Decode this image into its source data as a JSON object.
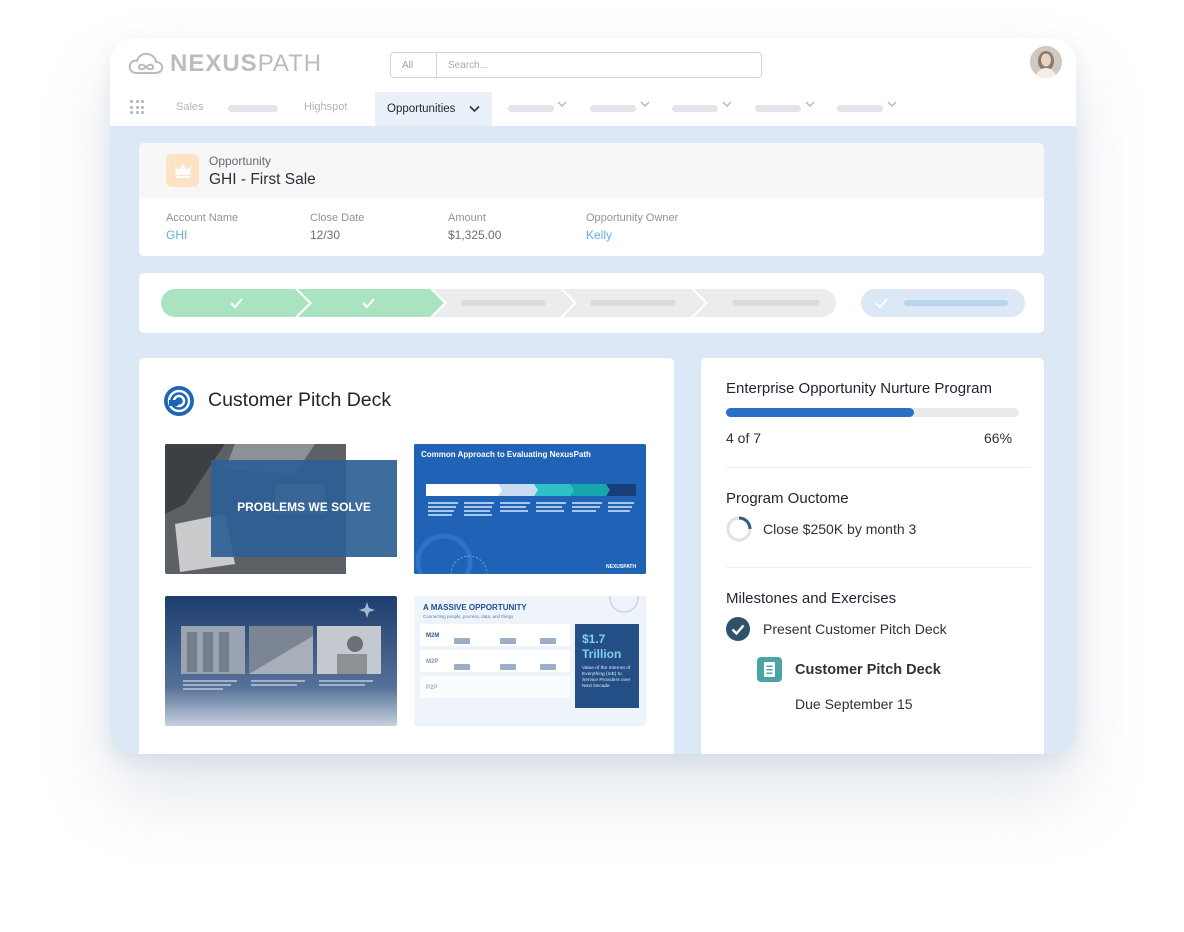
{
  "app": {
    "logo_text_bold": "NEXUS",
    "logo_text_light": "PATH",
    "logo_icon": "cloud-infinity-icon"
  },
  "search": {
    "scope": "All",
    "placeholder": "Search..."
  },
  "nav": {
    "items": [
      "Sales",
      "Highspot"
    ],
    "active_tab": "Opportunities"
  },
  "record": {
    "type_label": "Opportunity",
    "name": "GHI - First Sale",
    "fields": [
      {
        "label": "Account Name",
        "value": "GHI",
        "is_link": true
      },
      {
        "label": "Close Date",
        "value": "12/30",
        "is_link": false
      },
      {
        "label": "Amount",
        "value": "$1,325.00",
        "is_link": false
      },
      {
        "label": "Opportunity Owner",
        "value": "Kelly",
        "is_link": true
      }
    ]
  },
  "path": {
    "completed_steps": 2,
    "total_steps": 5,
    "complete_color": "#a9e3c2"
  },
  "deck": {
    "title": "Customer Pitch Deck",
    "slides": [
      {
        "title": "PROBLEMS WE SOLVE"
      },
      {
        "title": "Common Approach to Evaluating NexusPath",
        "footer": "NEXUSPATH"
      },
      {
        "title": ""
      },
      {
        "title": "A MASSIVE OPPORTUNITY",
        "subtitle": "Connecting people, process, data, and things",
        "rows": [
          "M2M",
          "M2P",
          "P2P"
        ],
        "stat_value": "$1.7 Trillion",
        "stat_caption": "Value of the Internet of Everything (IoE) to Service Providers over Next Decade"
      }
    ]
  },
  "program": {
    "title": "Enterprise Opportunity Nurture Program",
    "progress_label": "4 of 7",
    "progress_percent_label": "66%",
    "progress_fraction": 0.64,
    "outcome_heading": "Program Ouctome",
    "outcome_text": "Close $250K by month 3",
    "milestones_heading": "Milestones and Exercises",
    "milestone": "Present Customer Pitch Deck",
    "task_title": "Customer Pitch Deck",
    "task_due": "Due September 15"
  }
}
